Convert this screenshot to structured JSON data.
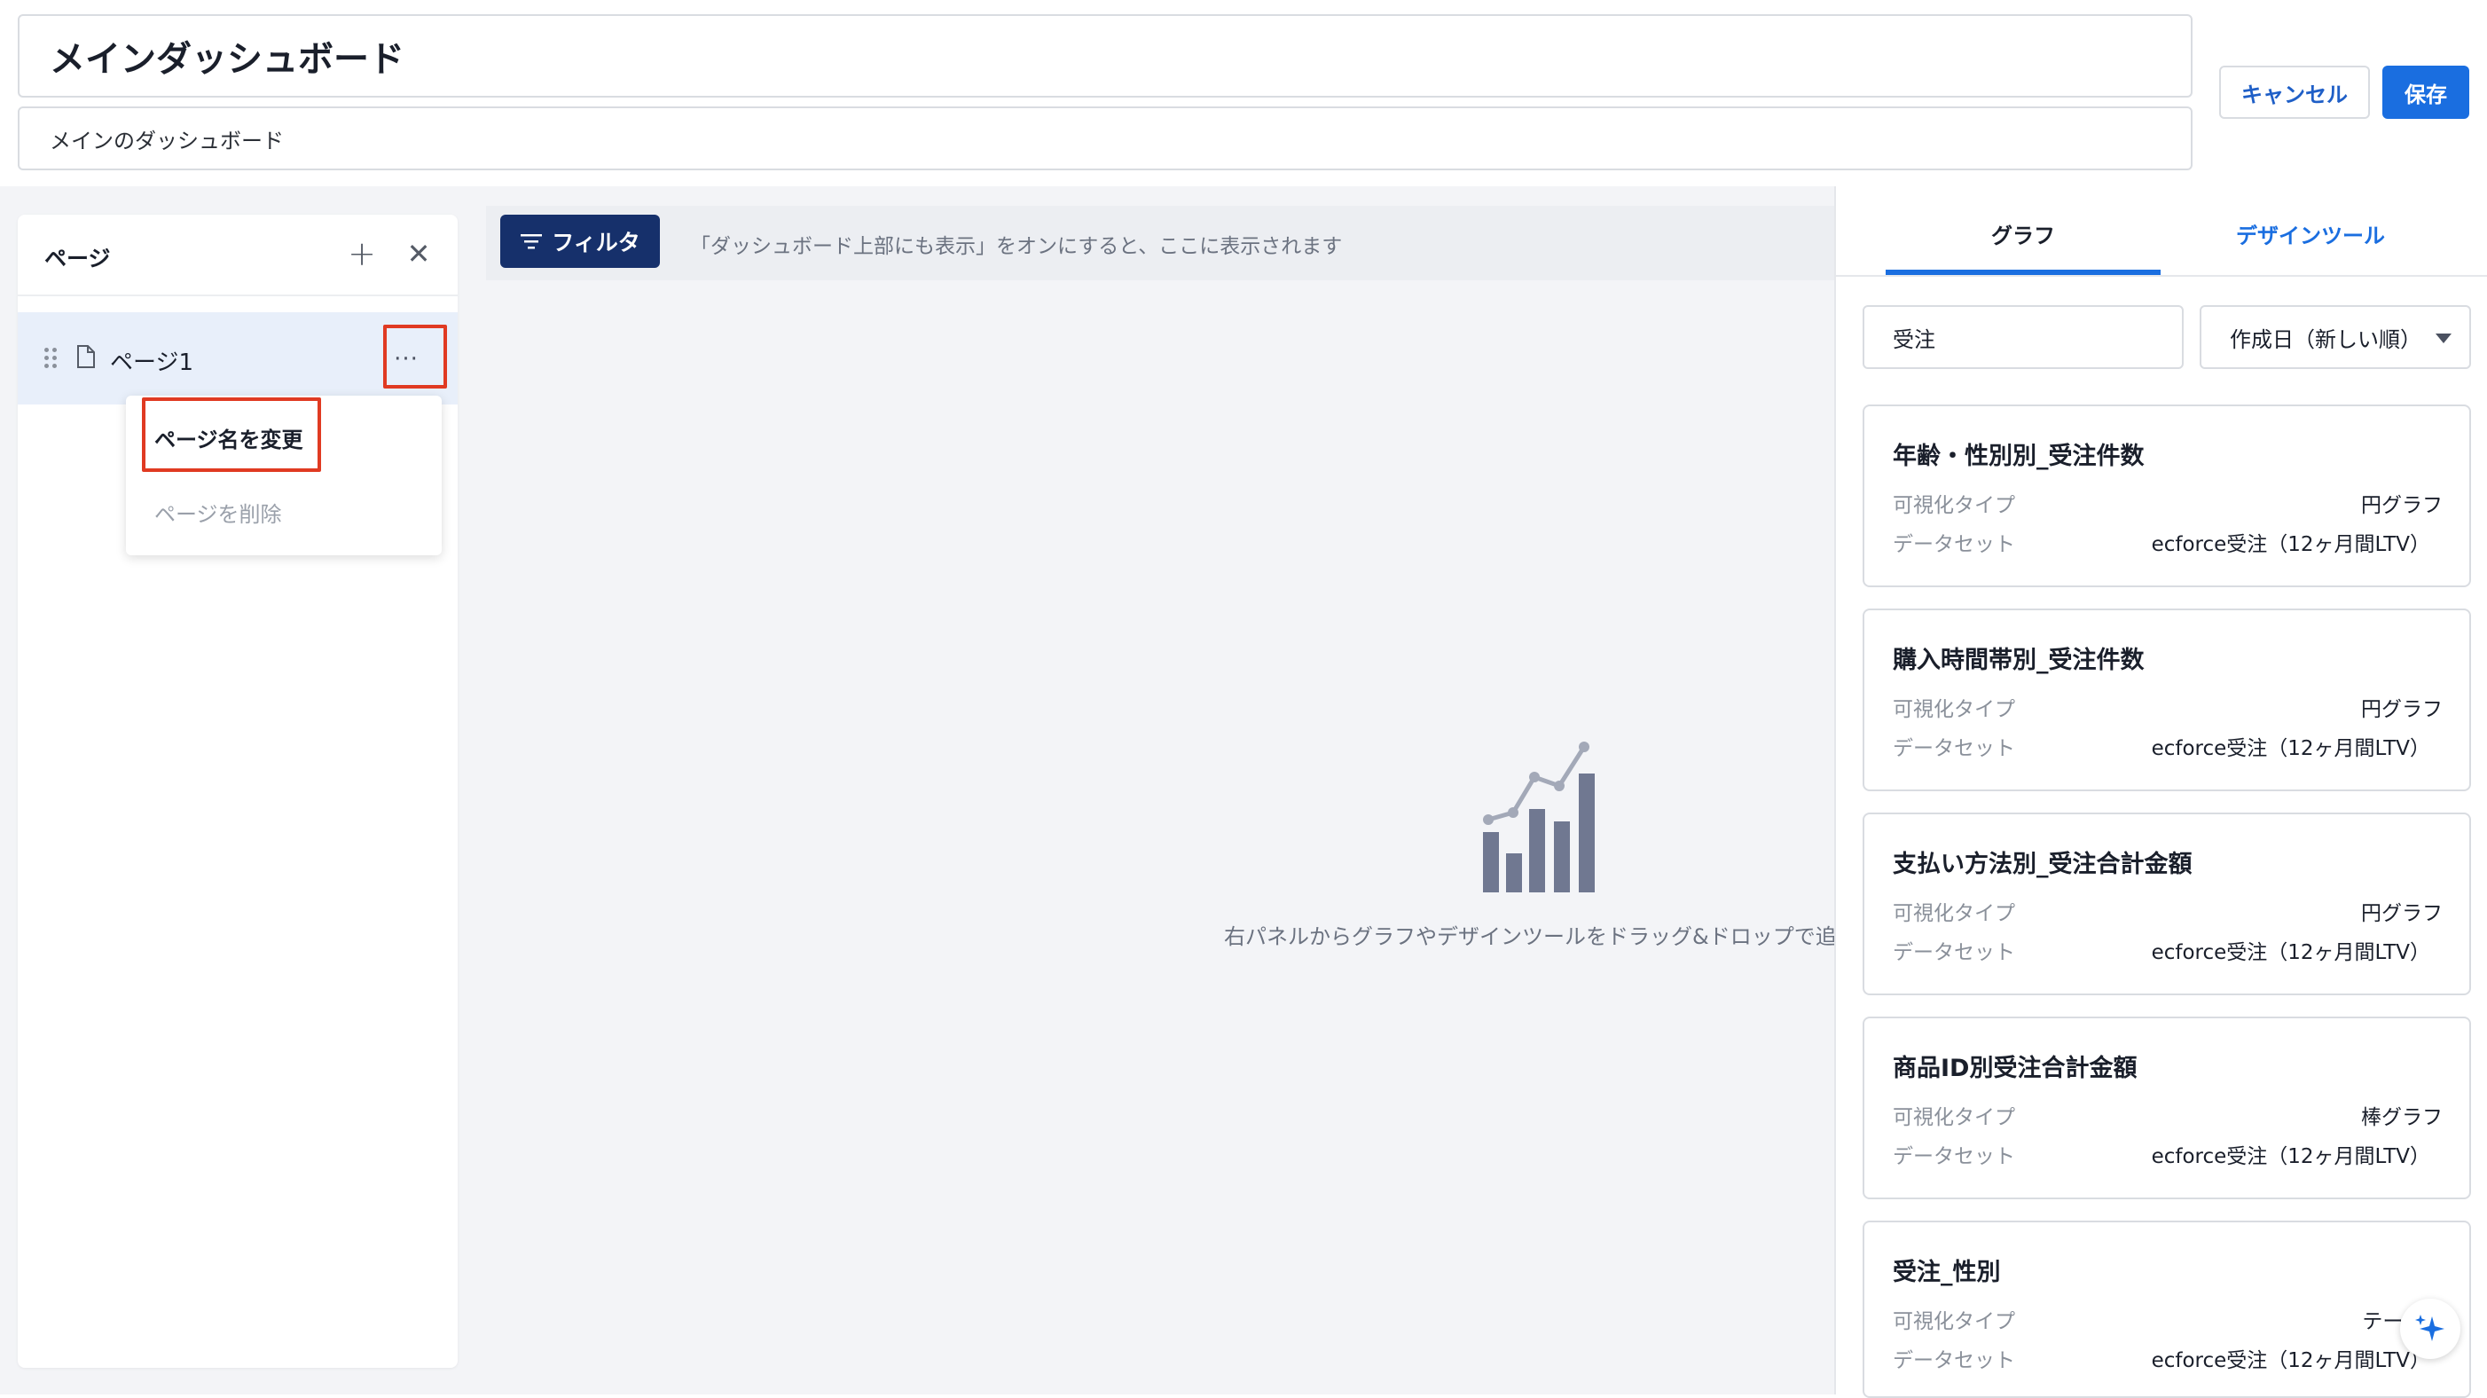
{
  "header": {
    "title": "メインダッシュボード",
    "description": "メインのダッシュボード",
    "cancel_label": "キャンセル",
    "save_label": "保存"
  },
  "sidebar": {
    "title": "ページ",
    "pages": [
      {
        "label": "ページ1"
      }
    ],
    "more_label": "···",
    "context_menu": {
      "rename_label": "ページ名を変更",
      "delete_label": "ページを削除"
    }
  },
  "filter_bar": {
    "button_label": "フィルタ",
    "hint": "「ダッシュボード上部にも表示」をオンにすると、ここに表示されます"
  },
  "canvas": {
    "empty_text": "右パネルからグラフやデザインツールをドラッグ&ドロップで追加"
  },
  "right_panel": {
    "tabs": [
      "グラフ",
      "デザインツール"
    ],
    "active_tab": "グラフ",
    "search_value": "受注",
    "sort_value": "作成日（新しい順）",
    "field_labels": {
      "vis_type": "可視化タイプ",
      "dataset": "データセット"
    },
    "cards": [
      {
        "title": "年齢・性別別_受注件数",
        "vis_type": "円グラフ",
        "dataset": "ecforce受注（12ヶ月間LTV）"
      },
      {
        "title": "購入時間帯別_受注件数",
        "vis_type": "円グラフ",
        "dataset": "ecforce受注（12ヶ月間LTV）"
      },
      {
        "title": "支払い方法別_受注合計金額",
        "vis_type": "円グラフ",
        "dataset": "ecforce受注（12ヶ月間LTV）"
      },
      {
        "title": "商品ID別受注合計金額",
        "vis_type": "棒グラフ",
        "dataset": "ecforce受注（12ヶ月間LTV）"
      },
      {
        "title": "受注_性別",
        "vis_type": "テーブル",
        "dataset": "ecforce受注（12ヶ月間LTV）"
      }
    ]
  },
  "colors": {
    "primary": "#1a6ee0",
    "filter_button": "#16306b",
    "highlight": "#e03a22",
    "selected_row": "#e8effa"
  }
}
